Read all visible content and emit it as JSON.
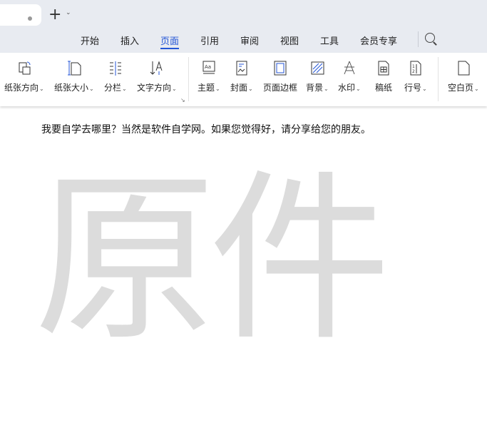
{
  "tabs": {
    "new_tab": "+",
    "dropdown": "⌄"
  },
  "menu": [
    "开始",
    "插入",
    "页面",
    "引用",
    "审阅",
    "视图",
    "工具",
    "会员专享"
  ],
  "active_menu": "页面",
  "ribbon": [
    {
      "label": "纸张方向",
      "icon": "page-orientation-icon",
      "dd": true
    },
    {
      "label": "纸张大小",
      "icon": "page-size-icon",
      "dd": true
    },
    {
      "label": "分栏",
      "icon": "columns-icon",
      "dd": true
    },
    {
      "label": "文字方向",
      "icon": "text-direction-icon",
      "dd": true
    },
    {
      "label": "主题",
      "icon": "theme-icon",
      "dd": true
    },
    {
      "label": "封面",
      "icon": "cover-icon",
      "dd": true
    },
    {
      "label": "页面边框",
      "icon": "page-border-icon",
      "dd": false
    },
    {
      "label": "背景",
      "icon": "background-icon",
      "dd": true
    },
    {
      "label": "水印",
      "icon": "watermark-icon",
      "dd": true
    },
    {
      "label": "稿纸",
      "icon": "manuscript-icon",
      "dd": false
    },
    {
      "label": "行号",
      "icon": "line-number-icon",
      "dd": true
    },
    {
      "label": "空白页",
      "icon": "blank-page-icon",
      "dd": true
    }
  ],
  "document": {
    "paragraph": "我要自学去哪里？当然是软件自学网。如果您觉得好，请分享给您的朋友。",
    "watermark": "原件"
  },
  "colors": {
    "accent": "#2456d6"
  }
}
